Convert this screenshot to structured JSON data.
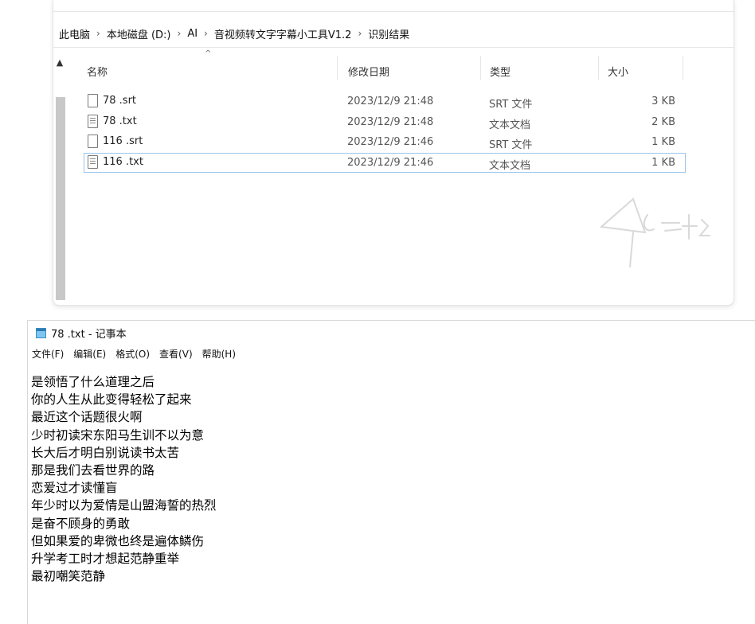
{
  "explorer": {
    "breadcrumb": [
      "此电脑",
      "本地磁盘 (D:)",
      "AI",
      "音视频转文字字幕小工具V1.2",
      "识别结果"
    ],
    "columns": {
      "name": "名称",
      "date": "修改日期",
      "type": "类型",
      "size": "大小"
    },
    "files": [
      {
        "name": "78 .srt",
        "date": "2023/12/9 21:48",
        "type": "SRT 文件",
        "size": "3 KB",
        "icon": "srt-file-icon"
      },
      {
        "name": "78 .txt",
        "date": "2023/12/9 21:48",
        "type": "文本文档",
        "size": "2 KB",
        "icon": "txt-file-icon"
      },
      {
        "name": "116 .srt",
        "date": "2023/12/9 21:46",
        "type": "SRT 文件",
        "size": "1 KB",
        "icon": "srt-file-icon"
      },
      {
        "name": "116 .txt",
        "date": "2023/12/9 21:46",
        "type": "文本文档",
        "size": "1 KB",
        "icon": "txt-file-icon"
      }
    ],
    "selected_index": 3
  },
  "notepad": {
    "title": "78 .txt - 记事本",
    "menu": [
      "文件(F)",
      "编辑(E)",
      "格式(O)",
      "查看(V)",
      "帮助(H)"
    ],
    "lines": [
      "是领悟了什么道理之后",
      "你的人生从此变得轻松了起来",
      "最近这个话题很火啊",
      "少时初读宋东阳马生训不以为意",
      "长大后才明白别说读书太苦",
      "那是我们去看世界的路",
      "恋爱过才读懂盲",
      "年少时以为爱情是山盟海誓的热烈",
      "是奋不顾身的勇敢",
      "但如果爱的卑微也终是遍体鳞伤",
      "升学考工时才想起范静重举",
      "最初嘲笑范静"
    ]
  },
  "colors": {
    "selection_border": "#99c4ec",
    "scroll_thumb": "#c8c8c8"
  }
}
